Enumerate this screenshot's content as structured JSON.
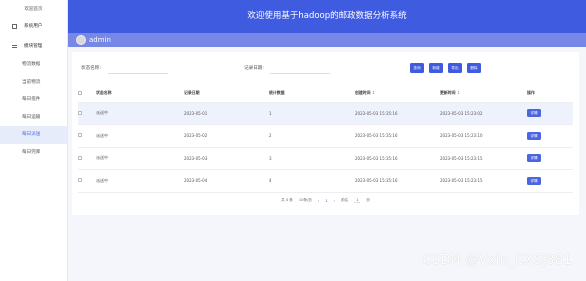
{
  "sidebar": {
    "title": "欢迎首页",
    "groups": [
      {
        "label": "系统用户",
        "icon": "system-users-icon"
      },
      {
        "label": "模块管理",
        "icon": "module-manage-icon"
      }
    ],
    "items": [
      "物流数据",
      "当前物流",
      "每日揽件",
      "每日运输",
      "每日派送",
      "每日完库"
    ],
    "active_index": 4
  },
  "header": {
    "banner_title": "欢迎使用基于hadoop的邮政数据分析系统",
    "username": "admin"
  },
  "search": {
    "status_label": "状态名称:",
    "date_label": "记录日期:",
    "buttons": {
      "search": "查询",
      "add": "新增",
      "export": "导出",
      "delete": "删除"
    }
  },
  "table": {
    "headers": [
      "",
      "状态名称",
      "记录日期",
      "统计数据",
      "创建时间",
      "更新时间",
      "操作"
    ],
    "rows": [
      {
        "status": "派送中",
        "date": "2023-05-01",
        "count": "1",
        "created": "2023-05-03 15:35:16",
        "updated": "2023-05-03 15:23:02"
      },
      {
        "status": "派送中",
        "date": "2023-05-02",
        "count": "2",
        "created": "2023-05-03 15:35:16",
        "updated": "2023-05-03 15:23:10"
      },
      {
        "status": "派送中",
        "date": "2023-05-03",
        "count": "3",
        "created": "2023-05-03 15:35:16",
        "updated": "2023-05-03 15:23:15"
      },
      {
        "status": "派送中",
        "date": "2023-05-04",
        "count": "4",
        "created": "2023-05-03 15:35:16",
        "updated": "2023-05-03 15:23:15"
      }
    ],
    "highlight_row": 0,
    "action_label": "详情"
  },
  "pagination": {
    "total": "共 4 条",
    "page_size": "10条/页",
    "prev": "‹",
    "current": "1",
    "next": "›",
    "goto": "前往",
    "page_input": "1",
    "page_unit": "页"
  },
  "watermark": "CSDN @Vxin_CXSJ881",
  "colors": {
    "primary": "#3f5be0",
    "userbar": "#7687e6",
    "active_bg": "#e7ecfb"
  }
}
